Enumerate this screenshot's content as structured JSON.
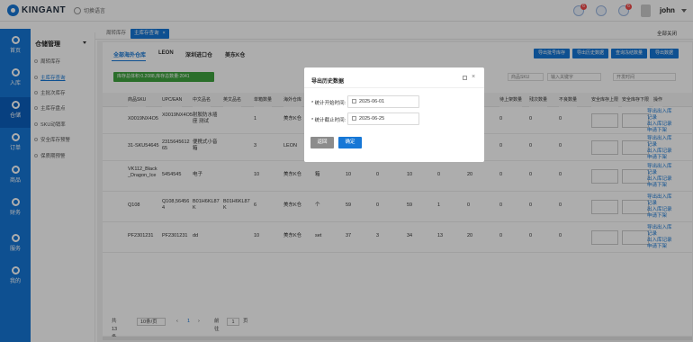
{
  "brand": {
    "name": "KINGANT"
  },
  "topbar": {
    "language": "切换语言",
    "badges": [
      "6",
      "",
      "6"
    ],
    "username": "john"
  },
  "tabs": [
    {
      "label": "周转库存"
    },
    {
      "label": "主库存查询",
      "close": "×"
    }
  ],
  "tabbar": {
    "close_all": "全部关闭"
  },
  "sidebar": [
    {
      "label": "首页"
    },
    {
      "label": "入库"
    },
    {
      "label": "仓储"
    },
    {
      "label": "订单"
    },
    {
      "label": "商品"
    },
    {
      "label": "财务"
    },
    {
      "label": "服务"
    },
    {
      "label": "我的"
    }
  ],
  "submenu": {
    "title": "仓储管理",
    "items": [
      "周转库存",
      "主库存查询",
      "主批次库存",
      "主库存盘点",
      "SKU动销率",
      "安全库存预警",
      "保质期预警"
    ]
  },
  "warehouse_tabs": [
    "全部海外仓库",
    "LEON",
    "深圳进口仓",
    "美东K仓"
  ],
  "actions": [
    "导出批号库存",
    "导出历史数据",
    "查询冻结数量",
    "导出数据"
  ],
  "summary": "库存总体积:0.2088,库存总数量:2041",
  "filters": {
    "field": "商品SKU",
    "placeholder": "输入关键字",
    "range": "开发时间"
  },
  "table": {
    "headers": [
      "商品SKU",
      "UPC/EAN",
      "中文品名",
      "英文品名",
      "单箱数量",
      "海外仓库",
      "存储",
      "可用库存",
      "在途库存",
      "实际库存",
      "冻结库存",
      "待入库",
      "待出库",
      "待上架数量",
      "残次数量",
      "不良数量",
      "安全库存上限",
      "安全库存下限",
      "操作"
    ],
    "rows": [
      {
        "sku": "X0019NX4O5",
        "upc": "X0019NX4O5",
        "cn": "射胶防水插座 测试",
        "en": "",
        "qty": "1",
        "wh": "美东K仓",
        "store": "",
        "v": [
          "",
          "",
          "",
          "",
          "",
          ""
        ],
        "a": "0",
        "b": "0",
        "c": "0"
      },
      {
        "sku": "31-SKU54645",
        "upc": "2315645612 65",
        "cn": "便携式小音箱",
        "en": "",
        "qty": "3",
        "wh": "LEON",
        "store": "",
        "v": [
          "",
          "",
          "",
          "",
          "",
          ""
        ],
        "a": "0",
        "b": "0",
        "c": "0"
      },
      {
        "sku": "VK112_Black _Dragon_Ice",
        "upc": "5454545",
        "cn": "电子",
        "en": "",
        "qty": "10",
        "wh": "美东K仓",
        "store": "箱",
        "v": [
          "10",
          "0",
          "10",
          "0",
          "20",
          "0"
        ],
        "a": "0",
        "b": "0",
        "c": "0"
      },
      {
        "sku": "Q108",
        "upc": "Q108,56456 4",
        "cn": "B01H6KL87 K",
        "en": "B01H6KL87 K",
        "qty": "6",
        "wh": "美东K仓",
        "store": "个",
        "v": [
          "59",
          "0",
          "59",
          "1",
          "0",
          "0"
        ],
        "a": "0",
        "b": "0",
        "c": "0"
      },
      {
        "sku": "PF2301231",
        "upc": "PF2301231",
        "cn": "dd",
        "en": "",
        "qty": "10",
        "wh": "美东K仓",
        "store": "set",
        "v": [
          "37",
          "3",
          "34",
          "13",
          "20",
          "0"
        ],
        "a": "0",
        "b": "0",
        "c": "0"
      }
    ],
    "op_links": [
      "导出出入库",
      "记录",
      "出入库记录",
      "申请下架"
    ]
  },
  "pager": {
    "total": "共 13 条",
    "size": "10条/页",
    "prev": "‹",
    "page": "1",
    "next": "›",
    "goto": "前往",
    "goto_val": "1",
    "suffix": "页"
  },
  "modal": {
    "title": "导出历史数据",
    "close": "×",
    "start_label": "* 统计开始时间:",
    "start_value": "2025-06-01",
    "end_label": "* 统计截止时间:",
    "end_value": "2025-06-25",
    "cancel": "返回",
    "confirm": "确定"
  }
}
